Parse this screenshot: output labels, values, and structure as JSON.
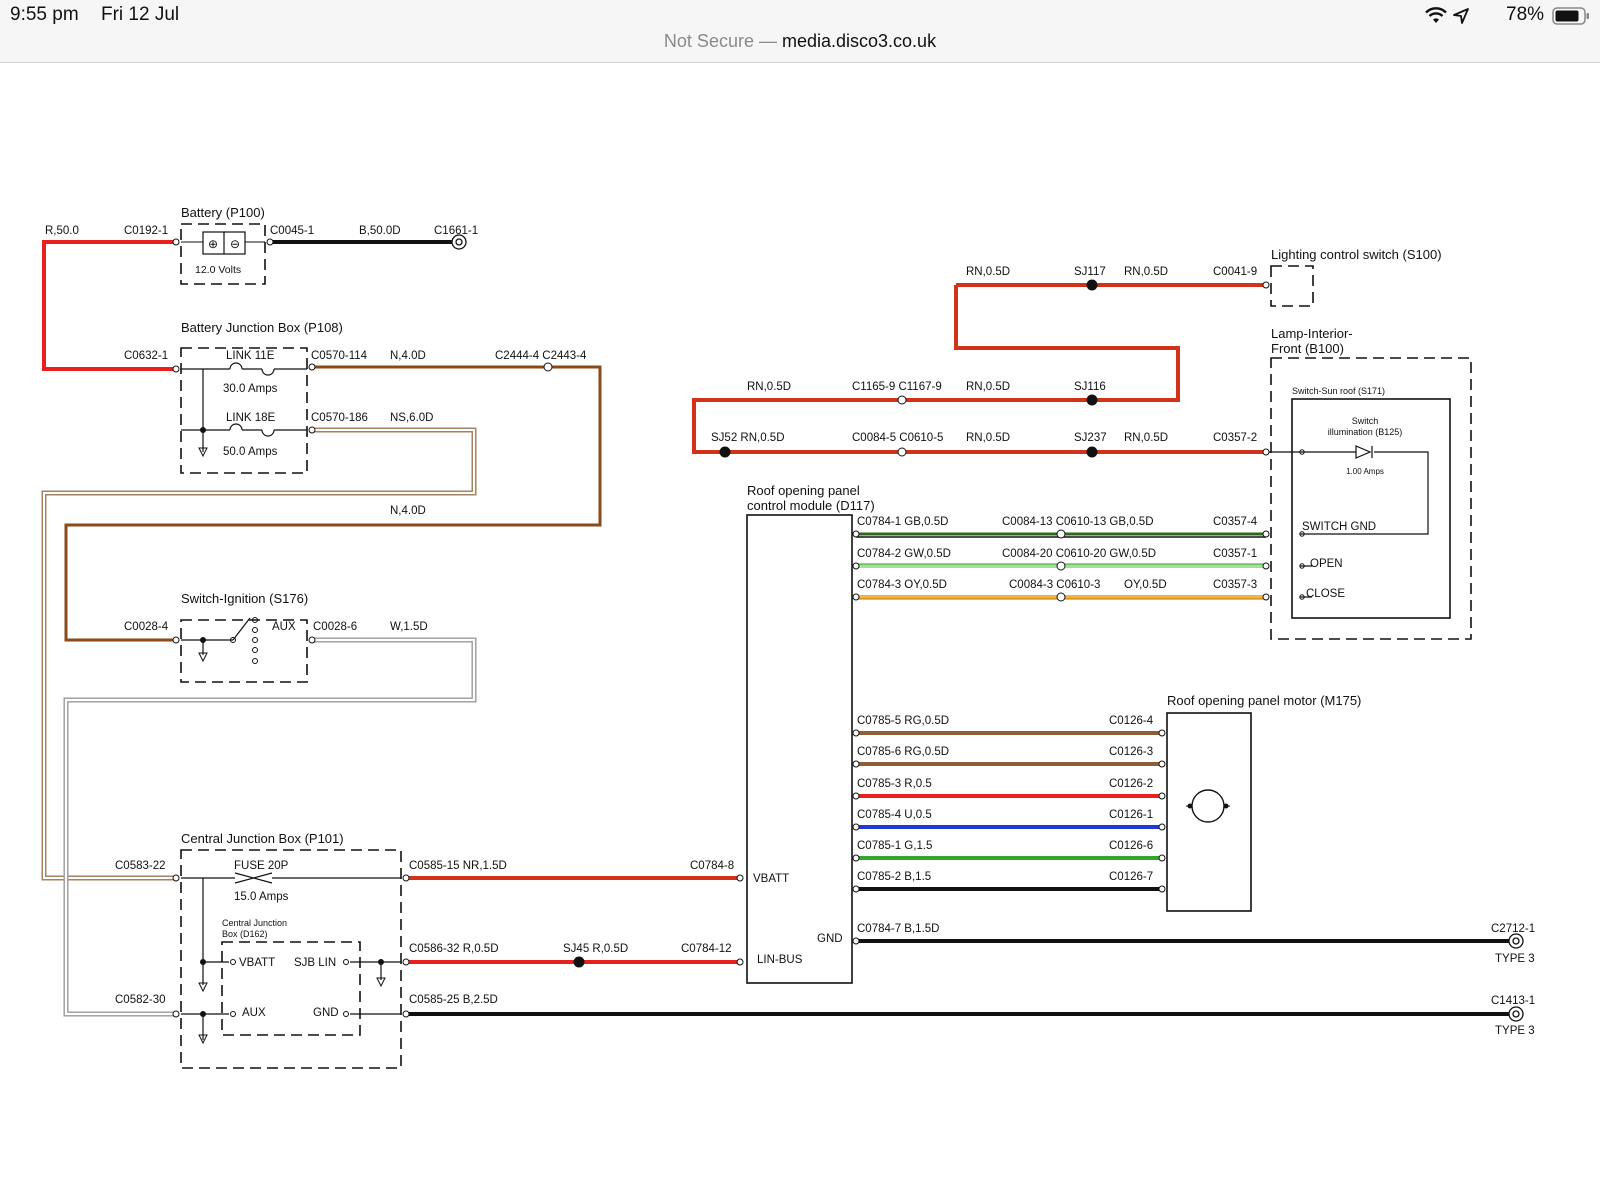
{
  "status_bar": {
    "time": "9:55 pm",
    "date": "Fri 12 Jul",
    "battery_percent": "78%",
    "url_prefix": "Not Secure —",
    "url_host": "media.disco3.co.uk",
    "icons": [
      "wifi-icon",
      "location-arrow-icon",
      "battery-icon"
    ]
  },
  "diagram": {
    "wire_colors": {
      "R": "#e8201e",
      "B": "#111111",
      "N": "#8a4b1a",
      "NS": "#c4a78a",
      "W": "#c8c8c8",
      "RN": "#d1321a",
      "GB": "#2c6a1c",
      "GW": "#a9dc9a",
      "OY": "#f2b43a",
      "RG": "#8f5d36",
      "U": "#1f38d6",
      "G": "#2da82d"
    },
    "components": {
      "battery": {
        "title": "Battery (P100)",
        "voltage": "12.0 Volts"
      },
      "bjb": {
        "title": "Battery Junction Box (P108)",
        "link1": "LINK 11E",
        "link1_amps": "30.0 Amps",
        "link2": "LINK 18E",
        "link2_amps": "50.0 Amps"
      },
      "ignition": {
        "title": "Switch-Ignition (S176)",
        "aux": "AUX"
      },
      "cjb": {
        "title": "Central Junction Box (P101)",
        "fuse": "FUSE 20P",
        "fuse_amps": "15.0 Amps",
        "sub_title_1": "Central Junction",
        "sub_title_2": "Box (D162)",
        "vbatt": "VBATT",
        "sjb_lin": "SJB LIN",
        "aux": "AUX",
        "gnd": "GND"
      },
      "module": {
        "title_1": "Roof opening panel",
        "title_2": "control module (D117)",
        "vbatt": "VBATT",
        "gnd": "GND",
        "lin_bus": "LIN-BUS"
      },
      "lighting_switch": {
        "title": "Lighting control switch (S100)"
      },
      "lamp": {
        "title_1": "Lamp-Interior-",
        "title_2": "Front (B100)",
        "sunroof_switch": "Switch-Sun roof (S171)",
        "illum_1": "Switch",
        "illum_2": "illumination (B125)",
        "illum_amps": "1.00 Amps",
        "switch_gnd": "SWITCH GND",
        "open": "OPEN",
        "close": "CLOSE"
      },
      "motor": {
        "title": "Roof opening panel motor (M175)"
      },
      "ground_type_1": "TYPE 3",
      "ground_type_2": "TYPE 3"
    },
    "labels": {
      "r50": "R,50.0",
      "c0192_1": "C0192-1",
      "c0045_1": "C0045-1",
      "b50d": "B,50.0D",
      "c1661_1": "C1661-1",
      "c0632_1": "C0632-1",
      "c0570_114": "C0570-114",
      "n40d_a": "N,4.0D",
      "c2444": "C2444-4 C2443-4",
      "c0570_186": "C0570-186",
      "ns60d": "NS,6.0D",
      "n40d_b": "N,4.0D",
      "c0028_4": "C0028-4",
      "c0028_6": "C0028-6",
      "w15d": "W,1.5D",
      "c0583_22": "C0583-22",
      "c0582_30": "C0582-30",
      "c0585_15": "C0585-15  NR,1.5D",
      "c0784_8": "C0784-8",
      "c0586_32": "C0586-32  R,0.5D",
      "sj45": "SJ45  R,0.5D",
      "c0784_12": "C0784-12",
      "c0585_25": "C0585-25  B,2.5D",
      "rn05d_top": "RN,0.5D",
      "sj117": "SJ117",
      "rn05d_top2": "RN,0.5D",
      "c0041_9": "C0041-9",
      "rn05d_mid": "RN,0.5D",
      "c1165": "C1165-9 C1167-9",
      "rn05d_mid2": "RN,0.5D",
      "sj116": "SJ116",
      "sj52": "SJ52  RN,0.5D",
      "c0084_5": "C0084-5 C0610-5",
      "rn05d_low": "RN,0.5D",
      "sj237": "SJ237",
      "rn05d_low2": "RN,0.5D",
      "c0357_2": "C0357-2",
      "c0784_1": "C0784-1  GB,0.5D",
      "c0084_13": "C0084-13 C0610-13 GB,0.5D",
      "c0357_4": "C0357-4",
      "c0784_2": "C0784-2  GW,0.5D",
      "c0084_20": "C0084-20 C0610-20 GW,0.5D",
      "c0357_1": "C0357-1",
      "c0784_3": "C0784-3  OY,0.5D",
      "c0084_3": "C0084-3 C0610-3",
      "oy05d": "OY,0.5D",
      "c0357_3": "C0357-3",
      "c0785_5": "C0785-5  RG,0.5D",
      "c0126_4": "C0126-4",
      "c0785_6": "C0785-6  RG,0.5D",
      "c0126_3": "C0126-3",
      "c0785_3": "C0785-3  R,0.5",
      "c0126_2": "C0126-2",
      "c0785_4": "C0785-4  U,0.5",
      "c0126_1": "C0126-1",
      "c0785_1": "C0785-1  G,1.5",
      "c0126_6": "C0126-6",
      "c0785_2": "C0785-2  B,1.5",
      "c0126_7": "C0126-7",
      "c0784_7": "C0784-7  B,1.5D",
      "c2712_1": "C2712-1",
      "c1413_1": "C1413-1"
    }
  }
}
